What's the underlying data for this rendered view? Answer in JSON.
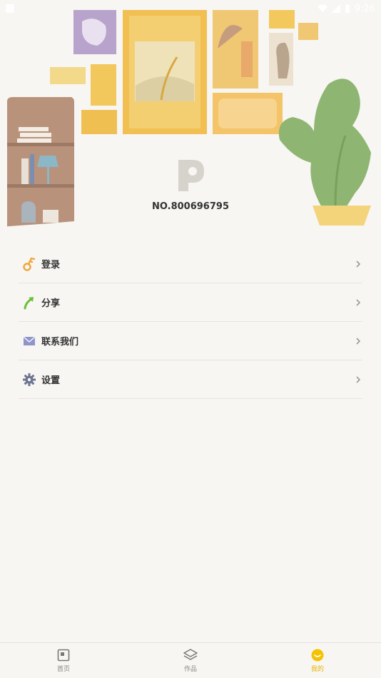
{
  "status": {
    "time": "9:26"
  },
  "profile": {
    "user_no": "NO.800696795"
  },
  "menu": {
    "items": [
      {
        "label": "登录",
        "icon": "key-icon"
      },
      {
        "label": "分享",
        "icon": "share-arrow-icon"
      },
      {
        "label": "联系我们",
        "icon": "mail-icon"
      },
      {
        "label": "设置",
        "icon": "gear-icon"
      }
    ]
  },
  "tabs": [
    {
      "label": "首页",
      "icon": "home-icon",
      "active": false
    },
    {
      "label": "作品",
      "icon": "layers-icon",
      "active": false
    },
    {
      "label": "我的",
      "icon": "smile-icon",
      "active": true
    }
  ],
  "colors": {
    "accent": "#f5c200",
    "background": "#f7f6f3",
    "hero_accent": "#f2c75b"
  }
}
